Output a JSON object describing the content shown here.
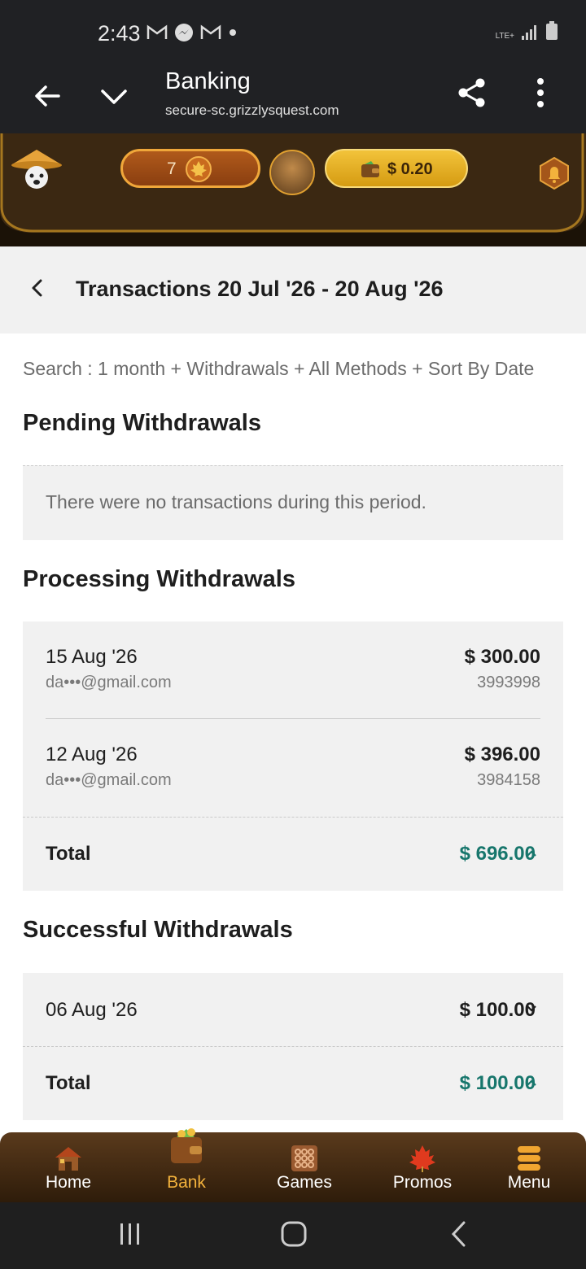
{
  "status_bar": {
    "time": "2:43",
    "network": "LTE+"
  },
  "browser": {
    "title": "Banking",
    "url": "secure-sc.grizzlysquest.com"
  },
  "game_header": {
    "level": "7",
    "balance": "$ 0.20"
  },
  "page": {
    "title": "Transactions 20 Jul '26 - 20 Aug '26",
    "search_summary": "Search : 1 month + Withdrawals + All Methods + Sort By Date"
  },
  "pending": {
    "title": "Pending Withdrawals",
    "empty_message": "There were no transactions during this period."
  },
  "processing": {
    "title": "Processing Withdrawals",
    "rows": [
      {
        "date": "15 Aug '26",
        "email": "da•••@gmail.com",
        "amount": "$ 300.00",
        "ref": "3993998"
      },
      {
        "date": "12 Aug '26",
        "email": "da•••@gmail.com",
        "amount": "$ 396.00",
        "ref": "3984158"
      }
    ],
    "total_label": "Total",
    "total_value": "$ 696.00"
  },
  "successful": {
    "title": "Successful Withdrawals",
    "rows": [
      {
        "date": "06 Aug '26",
        "amount": "$ 100.00"
      }
    ],
    "total_label": "Total",
    "total_value": "$ 100.00"
  },
  "bottom_nav": {
    "items": [
      {
        "label": "Home",
        "icon": "cabin-icon"
      },
      {
        "label": "Bank",
        "icon": "wallet-icon",
        "active": true
      },
      {
        "label": "Games",
        "icon": "games-grid-icon"
      },
      {
        "label": "Promos",
        "icon": "maple-leaf-icon"
      },
      {
        "label": "Menu",
        "icon": "menu-stack-icon"
      }
    ]
  },
  "colors": {
    "accent_total": "#17766c",
    "active_nav": "#f3b23c",
    "wallet_gold": "#f2c33a"
  }
}
